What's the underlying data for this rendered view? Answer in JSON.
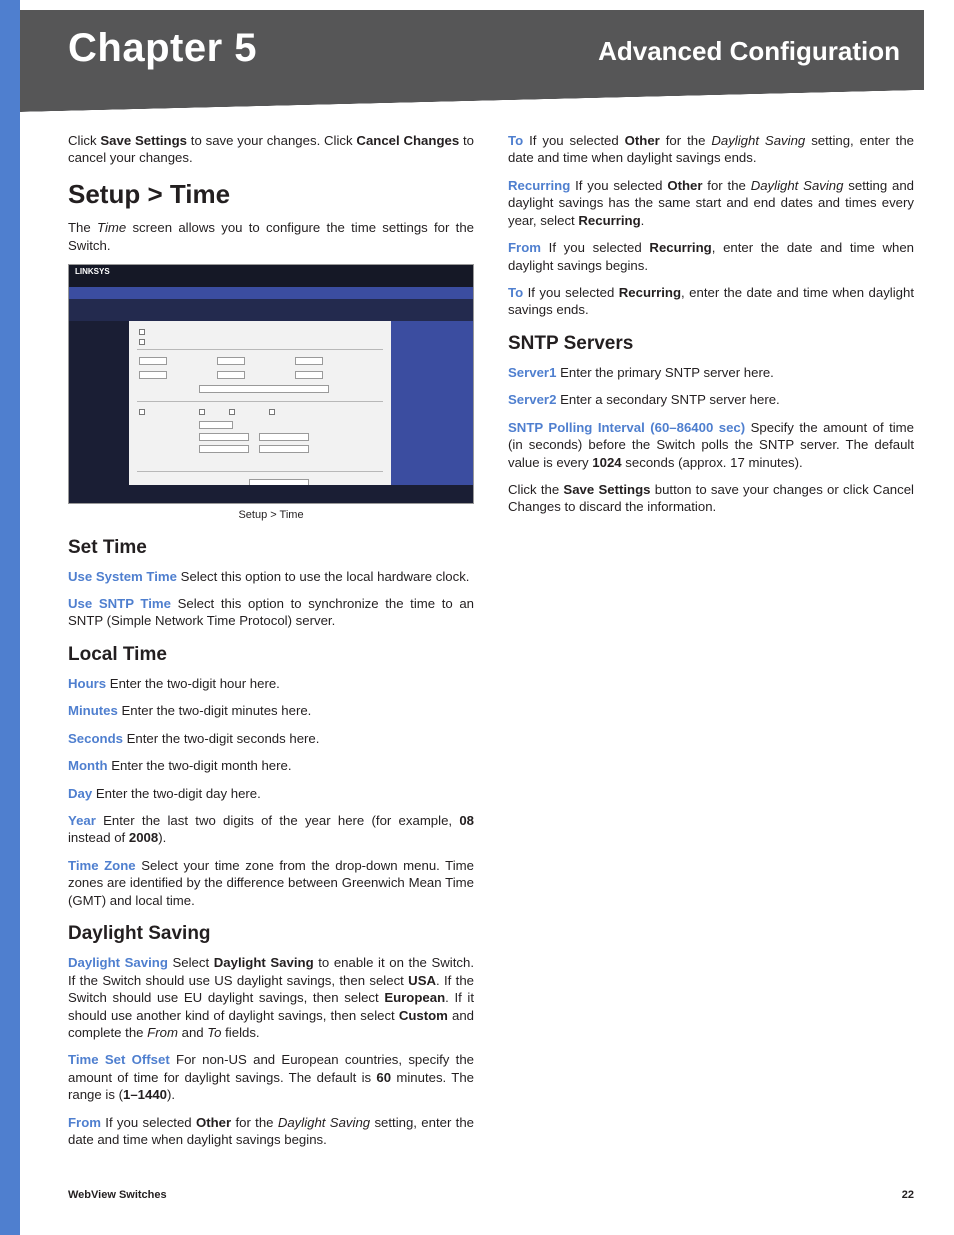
{
  "header": {
    "chapter": "Chapter 5",
    "section": "Advanced Configuration"
  },
  "footer": {
    "product": "WebView Switches",
    "page": "22"
  },
  "fig": {
    "brand": "LINKSYS",
    "caption": "Setup > Time"
  },
  "intro": {
    "p1a": "Click ",
    "p1b": "Save Settings",
    "p1c": " to save your changes. Click ",
    "p1d": "Cancel Changes",
    "p1e": " to cancel your changes."
  },
  "setup_time": {
    "title": "Setup > Time",
    "p1a": "The ",
    "p1b": "Time",
    "p1c": " screen allows you to configure the time settings for the Switch."
  },
  "set_time": {
    "title": "Set Time",
    "l1k": "Use System Time",
    "l1t": "  Select this option to use the local hardware clock.",
    "l2k": "Use SNTP Time",
    "l2t": "  Select this option to synchronize the time to an SNTP (Simple Network Time Protocol) server."
  },
  "local_time": {
    "title": "Local Time",
    "hours_k": "Hours",
    "hours_t": "  Enter the two-digit hour here.",
    "minutes_k": "Minutes",
    "minutes_t": "  Enter the two-digit minutes here.",
    "seconds_k": "Seconds",
    "seconds_t": "  Enter the two-digit seconds here.",
    "month_k": "Month",
    "month_t": "  Enter the two-digit month here.",
    "day_k": "Day",
    "day_t": "  Enter the two-digit day here.",
    "year_k": "Year",
    "year_t1": "  Enter the last two digits of the year here (for example, ",
    "year_b1": "08",
    "year_t2": " instead of ",
    "year_b2": "2008",
    "year_t3": ").",
    "tz_k": "Time Zone",
    "tz_t": "  Select your time zone from the drop-down menu. Time zones are identified by the difference between Greenwich Mean Time (GMT) and local time."
  },
  "daylight": {
    "title": "Daylight Saving",
    "ds_k": "Daylight Saving",
    "ds_t1": "  Select ",
    "ds_b1": "Daylight Saving",
    "ds_t2": " to enable it on the Switch. If the Switch should use US daylight savings, then select ",
    "ds_b2": "USA",
    "ds_t3": ". If the Switch should use EU daylight savings, then select ",
    "ds_b3": "European",
    "ds_t4": ". If it should use another kind of daylight savings, then select ",
    "ds_b4": "Custom",
    "ds_t5": " and complete the ",
    "ds_i1": "From",
    "ds_t6": " and ",
    "ds_i2": "To",
    "ds_t7": " fields.",
    "tso_k": "Time Set Offset",
    "tso_t1": "  For non-US and European countries, specify the amount of time for daylight savings. The default is ",
    "tso_b1": "60",
    "tso_t2": " minutes. The range is (",
    "tso_b2": "1–1440",
    "tso_t3": ").",
    "from_k": "From",
    "from_t1": "  If you selected ",
    "from_b1": "Other",
    "from_t2": " for the ",
    "from_i1": "Daylight Saving",
    "from_t3": " setting, enter the date and time when daylight savings begins.",
    "to_k": "To",
    "to_t1": "  If you selected ",
    "to_b1": "Other",
    "to_t2": " for the ",
    "to_i1": "Daylight Saving",
    "to_t3": " setting, enter the date and time when daylight savings ends.",
    "rec_k": "Recurring",
    "rec_t1": "  If you selected ",
    "rec_b1": "Other",
    "rec_t2": " for the ",
    "rec_i1": "Daylight Saving",
    "rec_t3": " setting and daylight savings has the same start and end dates and times every year, select ",
    "rec_b2": "Recurring",
    "rec_t4": ".",
    "rfrom_k": "From",
    "rfrom_t1": "  If you selected ",
    "rfrom_b1": "Recurring",
    "rfrom_t2": ", enter the date and time when daylight savings begins.",
    "rto_k": "To",
    "rto_t1": "  If you selected ",
    "rto_b1": "Recurring",
    "rto_t2": ", enter the date and time when daylight savings ends."
  },
  "sntp": {
    "title": "SNTP Servers",
    "s1_k": "Server1",
    "s1_t": "  Enter the primary SNTP server here.",
    "s2_k": "Server2",
    "s2_t": "  Enter a secondary SNTP server here.",
    "pi_k": "SNTP Polling Interval (60–86400 sec)",
    "pi_t1": " Specify the amount of time (in seconds) before the Switch polls the SNTP server. The default value is every ",
    "pi_b1": "1024",
    "pi_t2": " seconds (approx. 17 minutes).",
    "save_t1": "Click the ",
    "save_b1": "Save Settings",
    "save_t2": " button to save your changes or click Cancel Changes to discard the information."
  }
}
